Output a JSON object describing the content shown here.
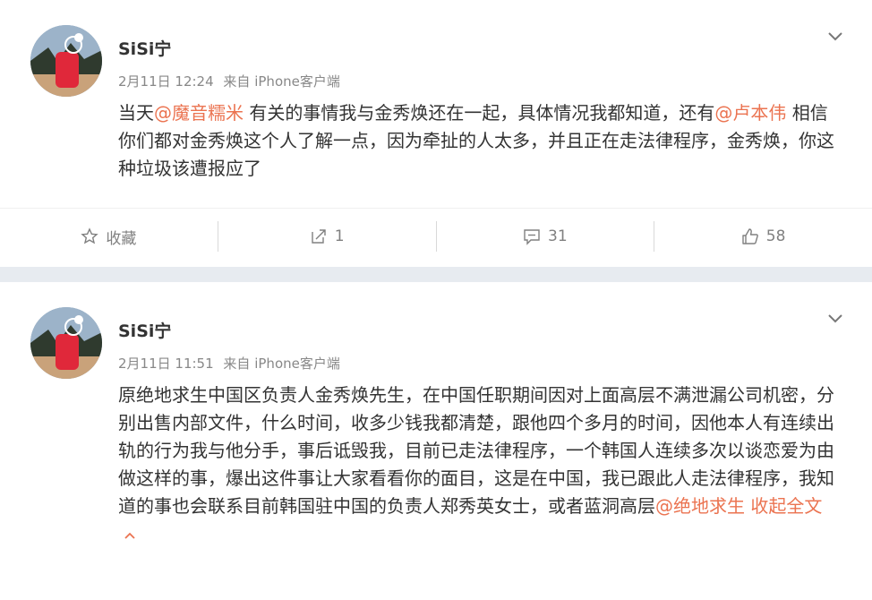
{
  "posts": [
    {
      "username": "SiSi宁",
      "date": "2月11日 12:24",
      "source_prefix": "来自",
      "source": "iPhone客户端",
      "content": [
        {
          "text": "当天",
          "mention": false
        },
        {
          "text": "@魔音糯米",
          "mention": true
        },
        {
          "text": " 有关的事情我与金秀焕还在一起，具体情况我都知道，还有",
          "mention": false
        },
        {
          "text": "@卢本伟",
          "mention": true
        },
        {
          "text": " 相信你们都对金秀焕这个人了解一点，因为牵扯的人太多，并且正在走法律程序，金秀焕，你这种垃圾该遭报应了",
          "mention": false
        }
      ],
      "actions": {
        "favorite_label": "收藏",
        "repost_count": "1",
        "comment_count": "31",
        "like_count": "58"
      }
    },
    {
      "username": "SiSi宁",
      "date": "2月11日 11:51",
      "source_prefix": "来自",
      "source": "iPhone客户端",
      "content": [
        {
          "text": "原绝地求生中国区负责人金秀焕先生，在中国任职期间因对上面高层不满泄漏公司机密，分别出售内部文件，什么时间，收多少钱我都清楚，跟他四个多月的时间，因他本人有连续出轨的行为我与他分手，事后诋毁我，目前已走法律程序，一个韩国人连续多次以谈恋爱为由做这样的事，爆出这件事让大家看看你的面目，这是在中国，我已跟此人走法律程序，我知道的事也会联系目前韩国驻中国的负责人郑秀英女士，或者蓝洞高层",
          "mention": false
        },
        {
          "text": "@绝地求生",
          "mention": true
        },
        {
          "text": " ",
          "mention": false
        }
      ],
      "collapse_label": "收起全文"
    }
  ],
  "colors": {
    "mention": "#eb7350",
    "background": "#e7ebf0",
    "meta_text": "#888888"
  },
  "icons": {
    "dropdown": "chevron-down-icon",
    "favorite": "star-icon",
    "repost": "repost-icon",
    "comment": "comment-icon",
    "like": "thumbs-up-icon",
    "collapse": "chevron-up-icon"
  }
}
